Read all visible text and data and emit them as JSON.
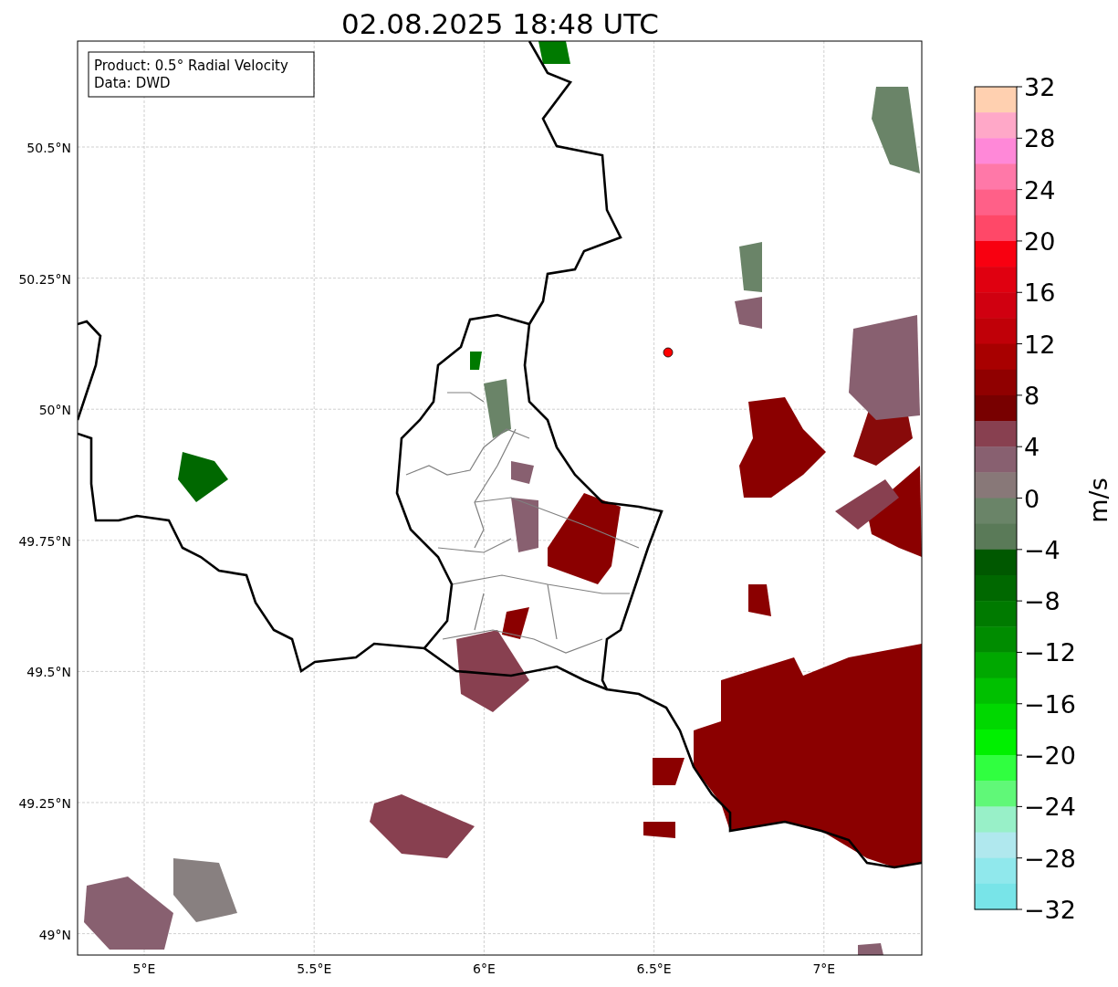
{
  "title": "02.08.2025 18:48 UTC",
  "info_box": [
    "Product: 0.5° Radial Velocity",
    "Data: DWD"
  ],
  "lat_ticks": [
    "50.5°N",
    "50.25°N",
    "50°N",
    "49.75°N",
    "49.5°N",
    "49.25°N",
    "49°N"
  ],
  "lon_ticks": [
    "5°E",
    "5.5°E",
    "6°E",
    "6.5°E",
    "7°E"
  ],
  "colorbar": {
    "label": "m/s",
    "ticks": [
      "32",
      "28",
      "24",
      "20",
      "16",
      "12",
      "8",
      "4",
      "0",
      "−4",
      "−8",
      "−12",
      "−16",
      "−20",
      "−24",
      "−28",
      "−32"
    ]
  }
}
